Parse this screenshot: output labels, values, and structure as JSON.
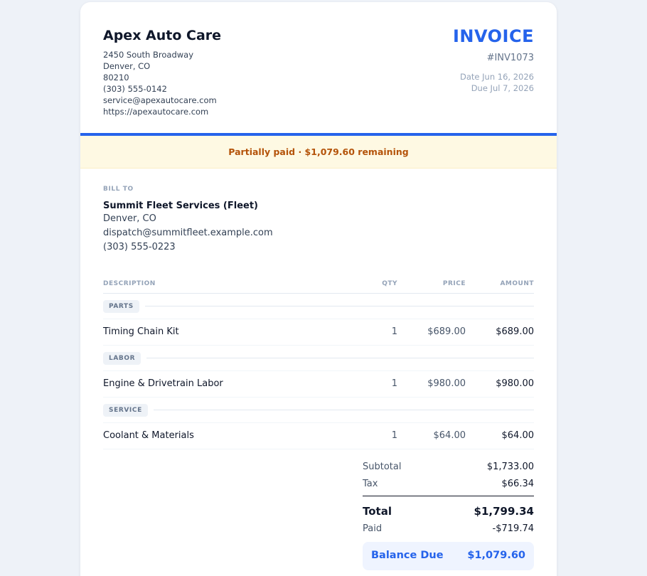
{
  "business": {
    "name": "Apex Auto Care",
    "address_line": "2450 South Broadway",
    "city_state": "Denver, CO",
    "zip": "80210",
    "phone": "(303) 555-0142",
    "email": "service@apexautocare.com",
    "website": "https://apexautocare.com"
  },
  "invoice": {
    "title": "INVOICE",
    "number": "#INV1073",
    "date": "Date Jun 16, 2026",
    "due": "Due Jul 7, 2026"
  },
  "status": {
    "text": "Partially paid · $1,079.60 remaining"
  },
  "bill_to": {
    "label": "BILL TO",
    "name": "Summit Fleet Services (Fleet)",
    "city_state": "Denver, CO",
    "email": "dispatch@summitfleet.example.com",
    "phone": "(303) 555-0223"
  },
  "table": {
    "headers": {
      "description": "DESCRIPTION",
      "qty": "QTY",
      "price": "PRICE",
      "amount": "AMOUNT"
    },
    "groups": [
      {
        "label": "PARTS",
        "items": [
          {
            "description": "Timing Chain Kit",
            "qty": "1",
            "price": "$689.00",
            "amount": "$689.00"
          }
        ]
      },
      {
        "label": "LABOR",
        "items": [
          {
            "description": "Engine & Drivetrain Labor",
            "qty": "1",
            "price": "$980.00",
            "amount": "$980.00"
          }
        ]
      },
      {
        "label": "SERVICE",
        "items": [
          {
            "description": "Coolant & Materials",
            "qty": "1",
            "price": "$64.00",
            "amount": "$64.00"
          }
        ]
      }
    ]
  },
  "totals": {
    "subtotal_label": "Subtotal",
    "subtotal": "$1,733.00",
    "tax_label": "Tax",
    "tax": "$66.34",
    "total_label": "Total",
    "total": "$1,799.34",
    "paid_label": "Paid",
    "paid": "-$719.74",
    "balance_label": "Balance Due",
    "balance": "$1,079.60"
  },
  "colors": {
    "accent": "#2563eb",
    "status_bg": "#fef9e3",
    "status_text": "#b45309"
  }
}
